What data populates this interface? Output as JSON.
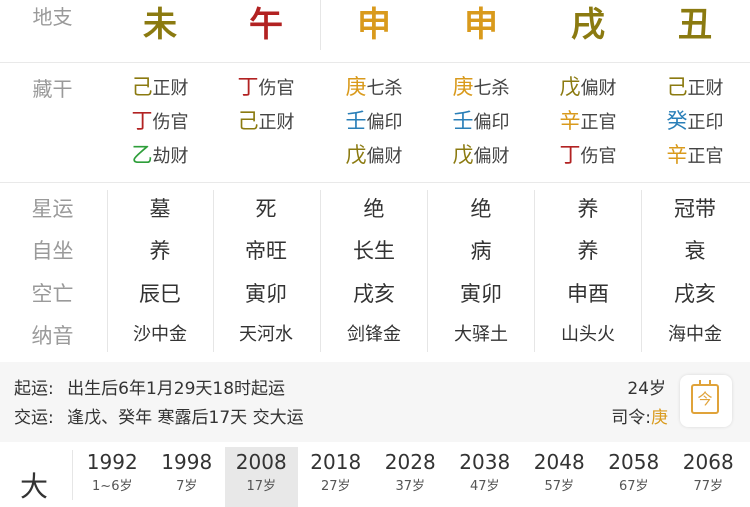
{
  "labels": {
    "dizhi": "地支",
    "canggan": "藏干",
    "xingyun": "星运",
    "zizuo": "自坐",
    "kongwang": "空亡",
    "nayin": "纳音",
    "dayun": "大"
  },
  "dizhi": [
    {
      "char": "未",
      "color": "#8b7a10"
    },
    {
      "char": "午",
      "color": "#b22222"
    },
    {
      "char": "申",
      "color": "#d99a1c"
    },
    {
      "char": "申",
      "color": "#d99a1c"
    },
    {
      "char": "戌",
      "color": "#8b7a10"
    },
    {
      "char": "丑",
      "color": "#8b7a10"
    }
  ],
  "canggan": [
    [
      {
        "g": "己",
        "s": "正财",
        "color": "#8b7a10"
      },
      {
        "g": "丁",
        "s": "伤官",
        "color": "#b22222"
      },
      {
        "g": "乙",
        "s": "劫财",
        "color": "#2e9e3a"
      }
    ],
    [
      {
        "g": "丁",
        "s": "伤官",
        "color": "#b22222"
      },
      {
        "g": "己",
        "s": "正财",
        "color": "#8b7a10"
      }
    ],
    [
      {
        "g": "庚",
        "s": "七杀",
        "color": "#d99a1c"
      },
      {
        "g": "壬",
        "s": "偏印",
        "color": "#2a7fb8"
      },
      {
        "g": "戊",
        "s": "偏财",
        "color": "#8b7a10"
      }
    ],
    [
      {
        "g": "庚",
        "s": "七杀",
        "color": "#d99a1c"
      },
      {
        "g": "壬",
        "s": "偏印",
        "color": "#2a7fb8"
      },
      {
        "g": "戊",
        "s": "偏财",
        "color": "#8b7a10"
      }
    ],
    [
      {
        "g": "戊",
        "s": "偏财",
        "color": "#8b7a10"
      },
      {
        "g": "辛",
        "s": "正官",
        "color": "#d99a1c"
      },
      {
        "g": "丁",
        "s": "伤官",
        "color": "#b22222"
      }
    ],
    [
      {
        "g": "己",
        "s": "正财",
        "color": "#8b7a10"
      },
      {
        "g": "癸",
        "s": "正印",
        "color": "#2a7fb8"
      },
      {
        "g": "辛",
        "s": "正官",
        "color": "#d99a1c"
      }
    ]
  ],
  "xingyun": [
    "墓",
    "死",
    "绝",
    "绝",
    "养",
    "冠带"
  ],
  "zizuo": [
    "养",
    "帝旺",
    "长生",
    "病",
    "养",
    "衰"
  ],
  "kongwang": [
    "辰巳",
    "寅卯",
    "戌亥",
    "寅卯",
    "申酉",
    "戌亥"
  ],
  "nayin": [
    "沙中金",
    "天河水",
    "剑锋金",
    "大驿土",
    "山头火",
    "海中金"
  ],
  "info": {
    "qiyun_label": "起运:",
    "qiyun_text": "出生后6年1月29天18时起运",
    "jiaoyun_label": "交运:",
    "jiaoyun_text": "逢戊、癸年 寒露后17天 交大运",
    "age": "24岁",
    "siling_label": "司令:",
    "siling_value": "庚",
    "calendar_glyph": "今"
  },
  "dayun": [
    {
      "year": "1992",
      "age": "1~6岁"
    },
    {
      "year": "1998",
      "age": "7岁"
    },
    {
      "year": "2008",
      "age": "17岁",
      "selected": true
    },
    {
      "year": "2018",
      "age": "27岁"
    },
    {
      "year": "2028",
      "age": "37岁"
    },
    {
      "year": "2038",
      "age": "47岁"
    },
    {
      "year": "2048",
      "age": "57岁"
    },
    {
      "year": "2058",
      "age": "67岁"
    },
    {
      "year": "2068",
      "age": "77岁"
    }
  ],
  "colors": {
    "accent_orange": "#d99a1c",
    "label_gray": "#9a9a9a"
  }
}
